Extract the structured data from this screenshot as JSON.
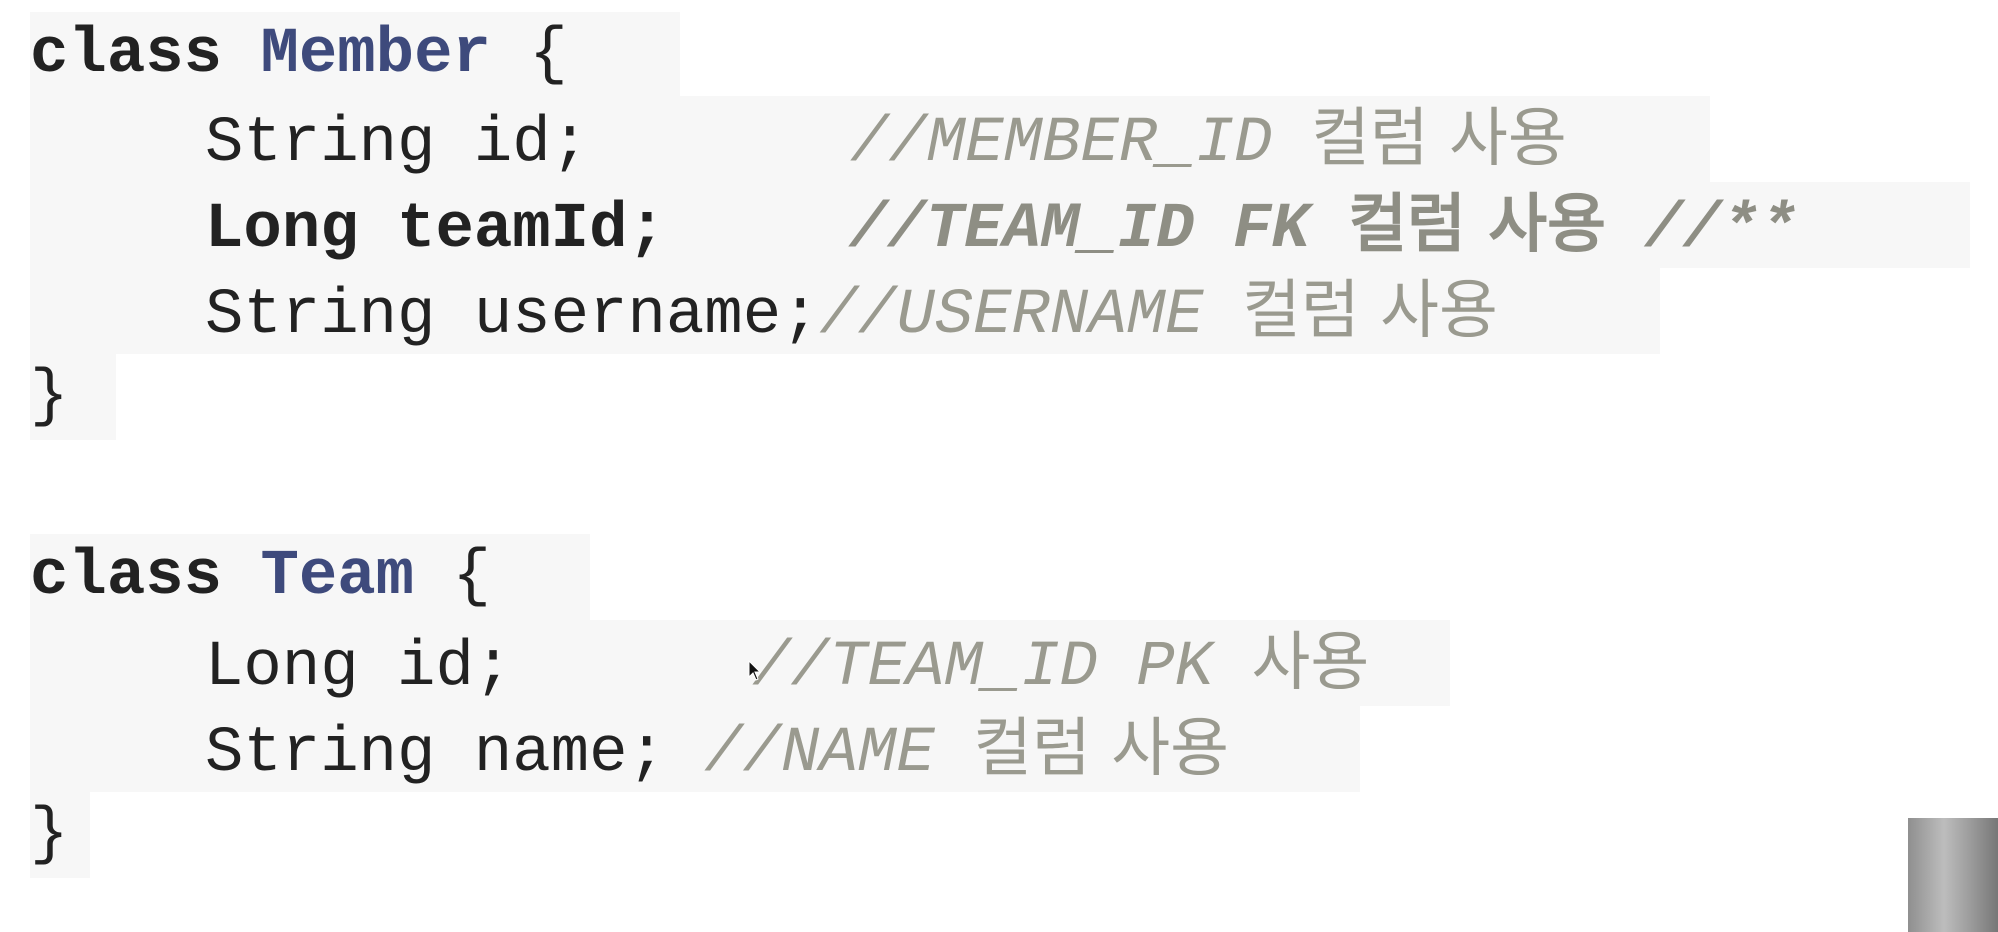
{
  "member_class": {
    "keyword": "class",
    "name": "Member",
    "open_brace": "{",
    "close_brace": "}",
    "fields": [
      {
        "code": "String id;",
        "comment": "//MEMBER_ID",
        "comment_ko": "컬럼 사용",
        "comment_tail": ""
      },
      {
        "code": "Long teamId;",
        "comment": "//TEAM_ID FK",
        "comment_ko": "컬럼 사용",
        "comment_tail": "//**"
      },
      {
        "code": "String username;",
        "comment": "//USERNAME",
        "comment_ko": "컬럼 사용",
        "comment_tail": ""
      }
    ]
  },
  "team_class": {
    "keyword": "class",
    "name": "Team",
    "open_brace": "{",
    "close_brace": "}",
    "fields": [
      {
        "code": "Long id;",
        "comment": "//TEAM_ID PK",
        "comment_ko": "사용"
      },
      {
        "code": "String name;",
        "comment": "//NAME",
        "comment_ko": "컬럼 사용"
      }
    ]
  },
  "colors": {
    "class_name": "#3e4a7c",
    "comment": "#9a9a8f",
    "code_background": "#f7f7f7",
    "text": "#222222"
  },
  "icons": [
    "mouse-cursor-icon"
  ]
}
